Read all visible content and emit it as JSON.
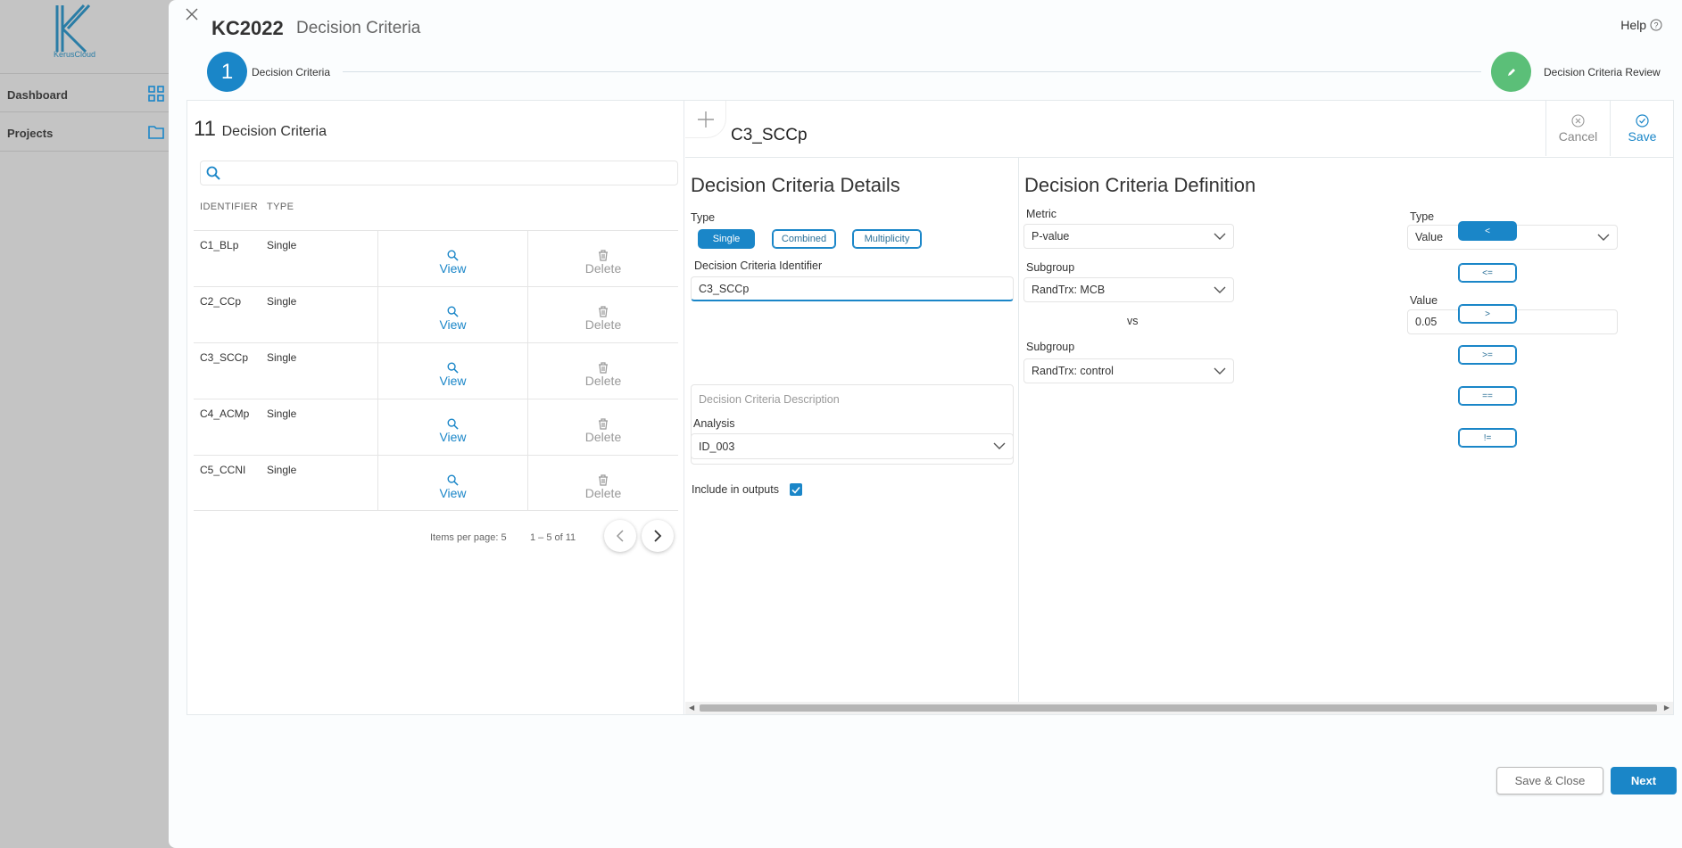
{
  "background": {
    "logo_text": "KerusCloud",
    "nav": [
      {
        "label": "Dashboard",
        "icon": "grid-icon"
      },
      {
        "label": "Projects",
        "icon": "folder-icon"
      }
    ]
  },
  "header": {
    "project_id": "KC2022",
    "title": "Decision Criteria",
    "help_label": "Help"
  },
  "stepper": {
    "step1_number": "1",
    "step1_label": "Decision Criteria",
    "step2_label": "Decision Criteria Review"
  },
  "list": {
    "count": "11",
    "count_label": "Decision Criteria",
    "search_placeholder": "",
    "columns": [
      "IDENTIFIER",
      "TYPE"
    ],
    "rows": [
      {
        "id": "C1_BLp",
        "type": "Single",
        "view": "View",
        "delete": "Delete"
      },
      {
        "id": "C2_CCp",
        "type": "Single",
        "view": "View",
        "delete": "Delete"
      },
      {
        "id": "C3_SCCp",
        "type": "Single",
        "view": "View",
        "delete": "Delete"
      },
      {
        "id": "C4_ACMp",
        "type": "Single",
        "view": "View",
        "delete": "Delete"
      },
      {
        "id": "C5_CCNI",
        "type": "Single",
        "view": "View",
        "delete": "Delete"
      }
    ],
    "items_per_page": "Items per page: 5",
    "range": "1 – 5 of 11"
  },
  "editor": {
    "criteria_name": "C3_SCCp",
    "cancel_label": "Cancel",
    "save_label": "Save"
  },
  "details": {
    "title": "Decision Criteria Details",
    "type_label": "Type",
    "type_options": [
      "Single",
      "Combined",
      "Multiplicity"
    ],
    "selected_type": "Single",
    "identifier_label": "Decision Criteria Identifier",
    "identifier_value": "C3_SCCp",
    "description_placeholder": "Decision Criteria Description",
    "analysis_label": "Analysis",
    "analysis_value": "ID_003",
    "include_label": "Include in outputs",
    "include_checked": true
  },
  "definition": {
    "title": "Decision Criteria Definition",
    "metric_label": "Metric",
    "metric_value": "P-value",
    "subgroup1_label": "Subgroup",
    "subgroup1_value": "RandTrx: MCB",
    "vs_label": "vs",
    "subgroup2_label": "Subgroup",
    "subgroup2_value": "RandTrx: control",
    "operators": [
      "<",
      "<=",
      ">",
      ">=",
      "==",
      "!="
    ],
    "selected_operator": "<",
    "type_label": "Type",
    "type_value": "Value",
    "value_label": "Value",
    "value": "0.05"
  },
  "footer": {
    "save_close_label": "Save & Close",
    "next_label": "Next"
  },
  "colors": {
    "primary": "#1a86c8",
    "success": "#5bbf78"
  }
}
